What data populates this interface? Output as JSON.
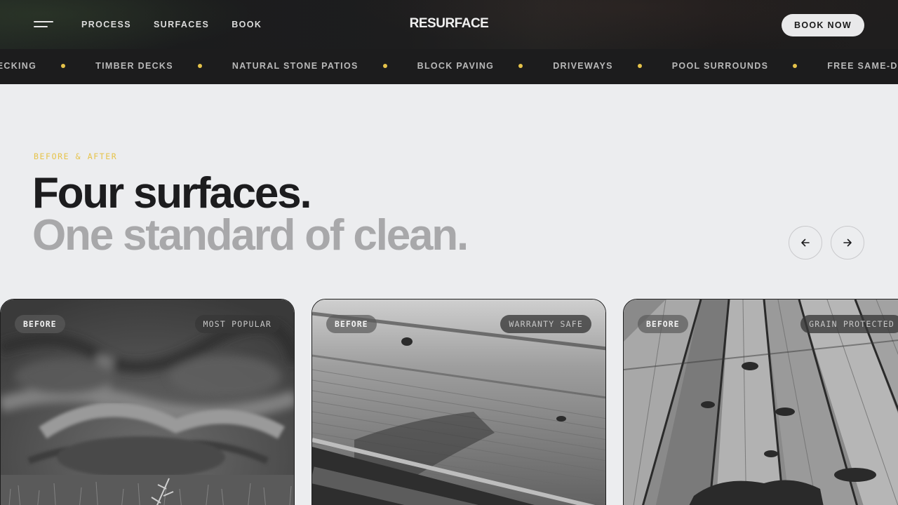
{
  "header": {
    "logo": "RESURFACE",
    "nav": [
      "PROCESS",
      "SURFACES",
      "BOOK"
    ],
    "cta": "BOOK NOW"
  },
  "marquee": {
    "items": [
      "E DECKING",
      "TIMBER DECKS",
      "NATURAL STONE PATIOS",
      "BLOCK PAVING",
      "DRIVEWAYS",
      "POOL SURROUNDS",
      "FREE SAME-DA"
    ]
  },
  "section": {
    "eyebrow": "BEFORE & AFTER",
    "headline_1": "Four surfaces.",
    "headline_2": "One standard of clean."
  },
  "cards": [
    {
      "before": "BEFORE",
      "tag": "MOST POPULAR"
    },
    {
      "before": "BEFORE",
      "tag": "WARRANTY SAFE"
    },
    {
      "before": "BEFORE",
      "tag": "GRAIN PROTECTED"
    }
  ],
  "colors": {
    "accent": "#e6c34a",
    "dark": "#1c1c1d",
    "background": "#ecedef"
  },
  "icons": {
    "menu": "hamburger-icon",
    "prev": "arrow-left-icon",
    "next": "arrow-right-icon"
  }
}
